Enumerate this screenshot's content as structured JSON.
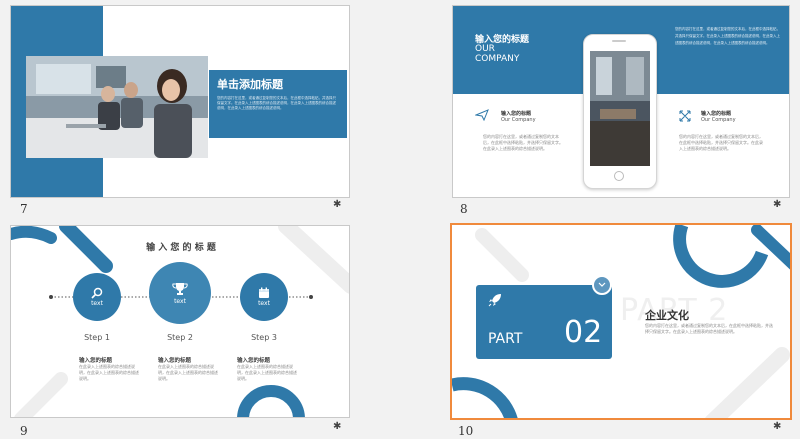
{
  "slides": [
    {
      "number": "7",
      "title": "单击添加标题",
      "body": "您的内容打在这里，或者通过复制您的文本后，在此框中选择粘贴，并选择只保留文字。在此录入上述图表的综合描述说明，在此录入上述图表的综合描述说明，在此录入上述图表的综合描述说明。"
    },
    {
      "number": "8",
      "title_cn": "输入您的标题",
      "title_en_1": "OUR",
      "title_en_2": "COMPANY",
      "top_text": "您的内容打在这里，或者通过复制您的文本后，在此框中选择粘贴，并选择只保留文字。在此录入上述图表的综合描述说明，在此录入上述图表的综合描述说明，在此录入上述图表的综合描述说明。",
      "left_item": {
        "title": "输入您的标题",
        "sub": "Our Company",
        "body": "您的内容打在这里，或者通过复制您的文本后，在此框中选择粘贴，并选择只保留文字。在此录入上述图表的综合描述说明。"
      },
      "right_item": {
        "title": "输入您的标题",
        "sub": "Our Company",
        "body": "您的内容打在这里，或者通过复制您的文本后，在此框中选择粘贴，并选择只保留文字。在此录入上述图表的综合描述说明。"
      }
    },
    {
      "number": "9",
      "title": "输 入 您 的 标 题",
      "steps": [
        {
          "icon_label": "text",
          "step": "Step 1",
          "heading": "输入您的标题",
          "body": "在此录入上述图表的综合描述说明，在此录入上述图表的综合描述说明。"
        },
        {
          "icon_label": "text",
          "step": "Step 2",
          "heading": "输入您的标题",
          "body": "在此录入上述图表的综合描述说明，在此录入上述图表的综合描述说明。"
        },
        {
          "icon_label": "text",
          "step": "Step 3",
          "heading": "输入您的标题",
          "body": "在此录入上述图表的综合描述说明，在此录入上述图表的综合描述说明。"
        }
      ]
    },
    {
      "number": "10",
      "part_label": "PART",
      "part_number": "02",
      "watermark": "PART 2",
      "title": "企业文化",
      "body": "您的内容打在这里，或者通过复制您的文本后，在此框中选择粘贴，并选择只保留文字。在此录入上述图表的综合描述说明。"
    }
  ],
  "colors": {
    "accent": "#2f79a9",
    "selection": "#f08a3c"
  }
}
